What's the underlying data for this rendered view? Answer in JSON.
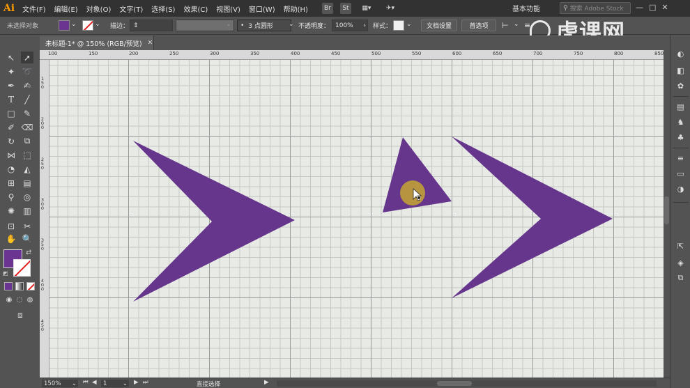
{
  "menubar": {
    "logo": "Ai",
    "items": [
      "文件(F)",
      "编辑(E)",
      "对象(O)",
      "文字(T)",
      "选择(S)",
      "效果(C)",
      "视图(V)",
      "窗口(W)",
      "帮助(H)"
    ],
    "buttons": [
      "Br",
      "St",
      "▦▾",
      "✈▾"
    ],
    "workspace": "基本功能",
    "stock_placeholder": "搜索 Adobe Stock",
    "window_controls": [
      "—",
      "□",
      "✕"
    ]
  },
  "controlbar": {
    "selection_label": "未选择对象",
    "fill_color": "#6a3490",
    "stroke_label": "描边：",
    "brush_label": "3 点圆形",
    "opacity_label": "不透明度：",
    "opacity_value": "100%",
    "style_label": "样式：",
    "doc_setup": "文档设置",
    "preferences": "首选项"
  },
  "watermark": "虎课网",
  "document": {
    "tab_title": "未标题-1* @ 150% (RGB/预览)"
  },
  "ruler": {
    "top_labels": [
      "100",
      "150",
      "200",
      "250",
      "300",
      "350",
      "400",
      "450",
      "500",
      "550",
      "600",
      "650",
      "700",
      "750",
      "800",
      "850"
    ],
    "left_labels": [
      "150",
      "200",
      "250",
      "300",
      "350",
      "400",
      "450"
    ]
  },
  "toolbar": {
    "fill_color": "#6a3490",
    "stroke": "none"
  },
  "statusbar": {
    "zoom": "150%",
    "page": "1",
    "tool": "直接选择"
  },
  "art": {
    "shape_color": "#66358c",
    "highlight_color": "#b79540",
    "shapes": [
      "chevron-left",
      "triangle-middle",
      "chevron-right"
    ]
  }
}
